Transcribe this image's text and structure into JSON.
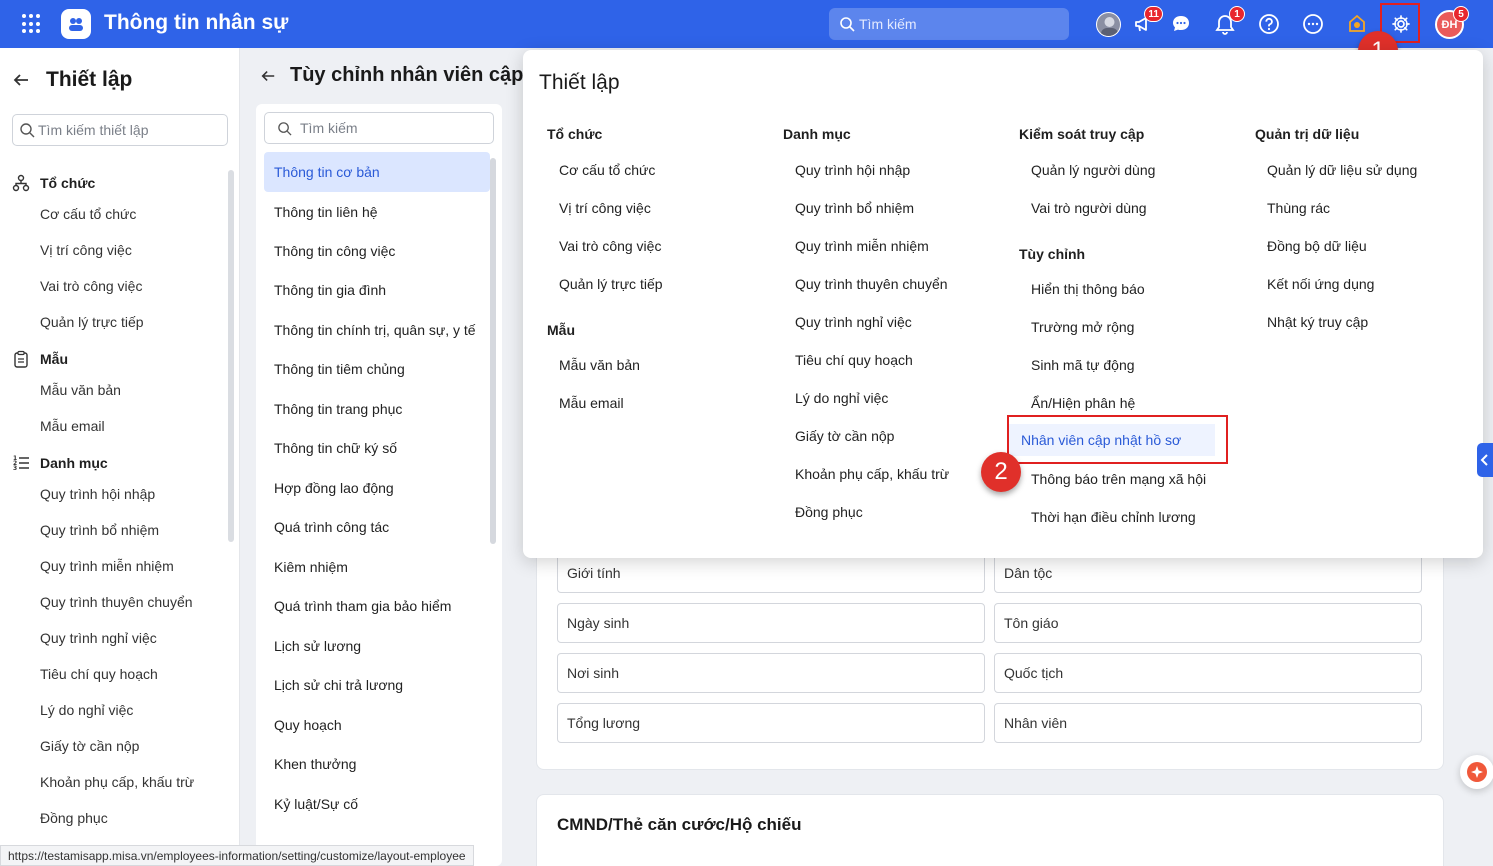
{
  "header": {
    "app_title": "Thông tin nhân sự",
    "search_placeholder": "Tìm kiếm",
    "megaphone_badge": "11",
    "bell_badge": "1",
    "user_initials": "ĐH",
    "user_badge": "5",
    "accent_color": "#2f63e8"
  },
  "left_panel": {
    "title": "Thiết lập",
    "search_placeholder": "Tìm kiếm thiết lập",
    "sections": [
      {
        "label": "Tổ chức",
        "icon": "org-icon",
        "items": [
          "Cơ cấu tổ chức",
          "Vị trí công việc",
          "Vai trò công việc",
          "Quản lý trực tiếp"
        ]
      },
      {
        "label": "Mẫu",
        "icon": "clipboard-icon",
        "items": [
          "Mẫu văn bản",
          "Mẫu email"
        ]
      },
      {
        "label": "Danh mục",
        "icon": "numbered-list-icon",
        "items": [
          "Quy trình hội nhập",
          "Quy trình bổ nhiệm",
          "Quy trình miễn nhiệm",
          "Quy trình thuyên chuyển",
          "Quy trình nghỉ việc",
          "Tiêu chí quy hoạch",
          "Lý do nghỉ việc",
          "Giấy tờ cần nộp",
          "Khoản phụ cấp, khấu trừ",
          "Đồng phục"
        ]
      }
    ]
  },
  "main": {
    "title": "Tùy chỉnh nhân viên cập",
    "list_search_placeholder": "Tìm kiếm",
    "list_items": [
      "Thông tin cơ bản",
      "Thông tin liên hệ",
      "Thông tin công việc",
      "Thông tin gia đình",
      "Thông tin chính trị, quân sự, y tế",
      "Thông tin tiêm chủng",
      "Thông tin trang phục",
      "Thông tin chữ ký số",
      "Hợp đồng lao động",
      "Quá trình công tác",
      "Kiêm nhiệm",
      "Quá trình tham gia bảo hiểm",
      "Lịch sử lương",
      "Lịch sử chi trả lương",
      "Quy hoạch",
      "Khen thưởng",
      "Kỷ luật/Sự cố"
    ],
    "fields": [
      "Giới tính",
      "Dân tộc",
      "Ngày sinh",
      "Tôn giáo",
      "Nơi sinh",
      "Quốc tịch",
      "Tổng lương",
      "Nhân viên"
    ],
    "section2_title": "CMND/Thẻ căn cước/Hộ chiếu"
  },
  "dropdown": {
    "title": "Thiết lập",
    "columns": [
      {
        "groups": [
          {
            "header": "Tổ chức",
            "items": [
              "Cơ cấu tổ chức",
              "Vị trí công việc",
              "Vai trò công việc",
              "Quản lý trực tiếp"
            ]
          },
          {
            "header": "Mẫu",
            "items": [
              "Mẫu văn bản",
              "Mẫu email"
            ]
          }
        ]
      },
      {
        "groups": [
          {
            "header": "Danh mục",
            "items": [
              "Quy trình hội nhập",
              "Quy trình bổ nhiệm",
              "Quy trình miễn nhiệm",
              "Quy trình thuyên chuyển",
              "Quy trình nghỉ việc",
              "Tiêu chí quy hoạch",
              "Lý do nghỉ việc",
              "Giấy tờ cần nộp",
              "Khoản phụ cấp, khấu trừ",
              "Đồng phục"
            ]
          }
        ]
      },
      {
        "groups": [
          {
            "header": "Kiểm soát truy cập",
            "items": [
              "Quản lý người dùng",
              "Vai trò người dùng"
            ]
          },
          {
            "header": "Tùy chỉnh",
            "items": [
              "Hiển thị thông báo",
              "Trường mở rộng",
              "Sinh mã tự động",
              "Ẩn/Hiện phân hệ",
              "Nhân viên cập nhật hồ sơ",
              "Thông báo trên mạng xã hội",
              "Thời hạn điều chỉnh lương"
            ]
          }
        ]
      },
      {
        "groups": [
          {
            "header": "Quản trị dữ liệu",
            "items": [
              "Quản lý dữ liệu sử dụng",
              "Thùng rác",
              "Đồng bộ dữ liệu",
              "Kết nối ứng dụng",
              "Nhật ký truy cập"
            ]
          }
        ]
      }
    ]
  },
  "annotations": {
    "step1": "1",
    "step2": "2"
  },
  "status_url": "https://testamisapp.misa.vn/employees-information/setting/customize/layout-employee"
}
